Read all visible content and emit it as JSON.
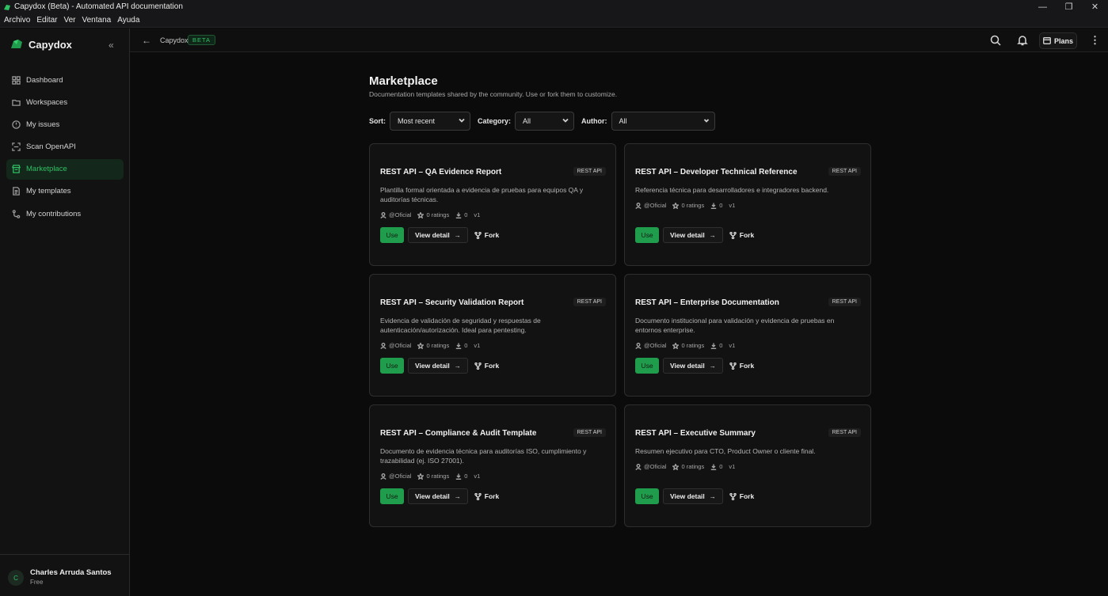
{
  "window": {
    "title": "Capydox (Beta) - Automated API documentation"
  },
  "menubar": [
    "Archivo",
    "Editar",
    "Ver",
    "Ventana",
    "Ayuda"
  ],
  "sidebar": {
    "brand": "Capydox",
    "items": [
      {
        "label": "Dashboard",
        "icon": "dashboard-icon"
      },
      {
        "label": "Workspaces",
        "icon": "folder-icon"
      },
      {
        "label": "My issues",
        "icon": "issue-circle-icon"
      },
      {
        "label": "Scan OpenAPI",
        "icon": "scan-icon"
      },
      {
        "label": "Marketplace",
        "icon": "store-icon",
        "active": true
      },
      {
        "label": "My templates",
        "icon": "file-icon"
      },
      {
        "label": "My contributions",
        "icon": "git-contribution-icon"
      }
    ],
    "user": {
      "initial": "C",
      "name": "Charles Arruda Santos",
      "plan": "Free"
    }
  },
  "header": {
    "breadcrumb": "Capydox",
    "badge": "BETA",
    "plans_label": "Plans"
  },
  "main": {
    "title": "Marketplace",
    "subtitle": "Documentation templates shared by the community. Use or fork them to customize.",
    "filters": {
      "sort_label": "Sort:",
      "sort_value": "Most recent",
      "category_label": "Category:",
      "category_value": "All",
      "author_label": "Author:",
      "author_value": "All"
    },
    "actions": {
      "use": "Use",
      "detail": "View detail",
      "fork": "Fork"
    },
    "cards": [
      {
        "title": "REST API – QA Evidence Report",
        "tag": "REST API",
        "desc": "Plantilla formal orientada a evidencia de pruebas para equipos QA y auditorías técnicas.",
        "author": "@Oficial",
        "ratings": "0 ratings",
        "downloads": "0",
        "version": "v1"
      },
      {
        "title": "REST API – Developer Technical Reference",
        "tag": "REST API",
        "desc": "Referencia técnica para desarrolladores e integradores backend.",
        "author": "@Oficial",
        "ratings": "0 ratings",
        "downloads": "0",
        "version": "v1"
      },
      {
        "title": "REST API – Security Validation Report",
        "tag": "REST API",
        "desc": "Evidencia de validación de seguridad y respuestas de autenticación/autorización. Ideal para pentesting.",
        "author": "@Oficial",
        "ratings": "0 ratings",
        "downloads": "0",
        "version": "v1"
      },
      {
        "title": "REST API – Enterprise Documentation",
        "tag": "REST API",
        "desc": "Documento institucional para validación y evidencia de pruebas en entornos enterprise.",
        "author": "@Oficial",
        "ratings": "0 ratings",
        "downloads": "0",
        "version": "v1"
      },
      {
        "title": "REST API – Compliance & Audit Template",
        "tag": "REST API",
        "desc": "Documento de evidencia técnica para auditorías ISO, cumplimiento y trazabilidad (ej. ISO 27001).",
        "author": "@Oficial",
        "ratings": "0 ratings",
        "downloads": "0",
        "version": "v1"
      },
      {
        "title": "REST API – Executive Summary",
        "tag": "REST API",
        "desc": "Resumen ejecutivo para CTO, Product Owner o cliente final.",
        "author": "@Oficial",
        "ratings": "0 ratings",
        "downloads": "0",
        "version": "v1"
      }
    ]
  },
  "colors": {
    "accent": "#1f9d4c",
    "accent_text": "#2fbf63",
    "background": "#0b0b0b"
  }
}
